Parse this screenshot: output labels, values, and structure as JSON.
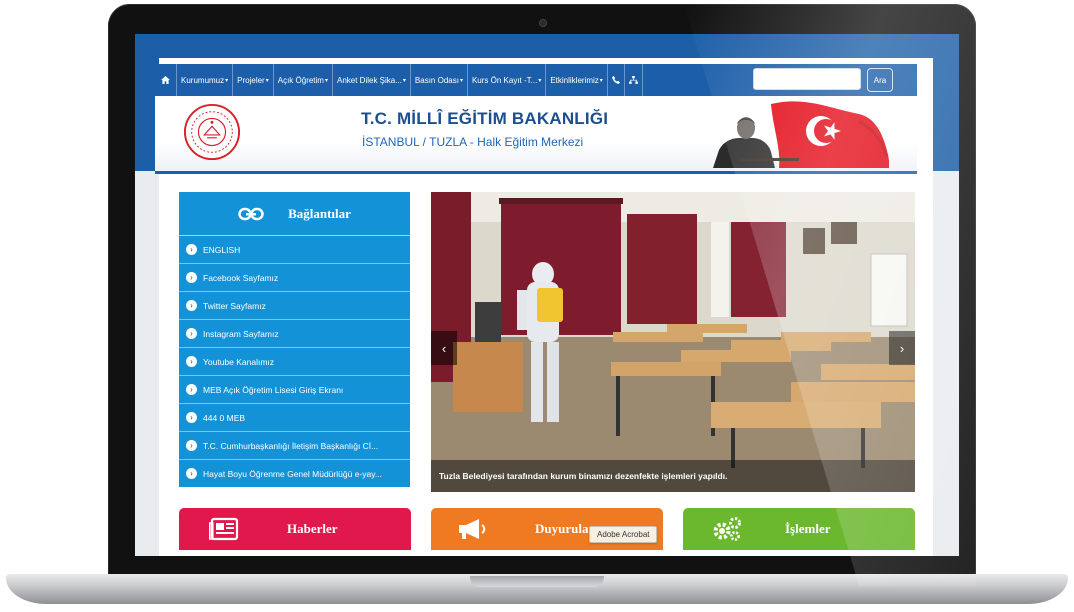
{
  "nav": {
    "home_icon": "home-icon",
    "items": [
      {
        "label": "Kurumumuz",
        "caret": "▾"
      },
      {
        "label": "Projeler",
        "caret": "▾"
      },
      {
        "label": "Açık Öğretim",
        "caret": "▾"
      },
      {
        "label": "Anket Dilek Şika...",
        "caret": "▾"
      },
      {
        "label": "Basın Odası",
        "caret": "▾"
      },
      {
        "label": "Kurs Ön Kayıt -T...",
        "caret": "▾"
      },
      {
        "label": "Etkinliklerimiz",
        "caret": "▾"
      }
    ],
    "phone_icon": "phone-icon",
    "sitemap_icon": "sitemap-icon"
  },
  "search": {
    "placeholder": "",
    "button_label": "Ara"
  },
  "header": {
    "title": "T.C. MİLLÎ EĞİTİM BAKANLIĞI",
    "subtitle": "İSTANBUL / TUZLA - Halk Eğitim Merkezi"
  },
  "links": {
    "header": "Bağlantılar",
    "items": [
      "ENGLISH",
      "Facebook Sayfamız",
      "Twitter Sayfamız",
      "Instagram Sayfamız",
      "Youtube Kanalımız",
      "MEB Açık Öğretim Lisesi Giriş Ekranı",
      "444 0 MEB",
      "T.C. Cumhurbaşkanlığı İletişim Başkanlığı Cİ...",
      "Hayat Boyu Öğrenme Genel Müdürlüğü e-yay..."
    ]
  },
  "slider": {
    "caption": "Tuzla Belediyesi tarafından kurum binamızı dezenfekte işlemleri yapıldı.",
    "prev": "‹",
    "next": "›"
  },
  "tiles": {
    "news": "Haberler",
    "announcements": "Duyurular",
    "operations": "İşlemler"
  },
  "tooltip": "Adobe Acrobat",
  "colors": {
    "brand_blue": "#1c5ea9",
    "links_blue": "#1392d8",
    "news_red": "#e0184b",
    "ann_orange": "#f07a22",
    "ops_green": "#6bb82e"
  }
}
